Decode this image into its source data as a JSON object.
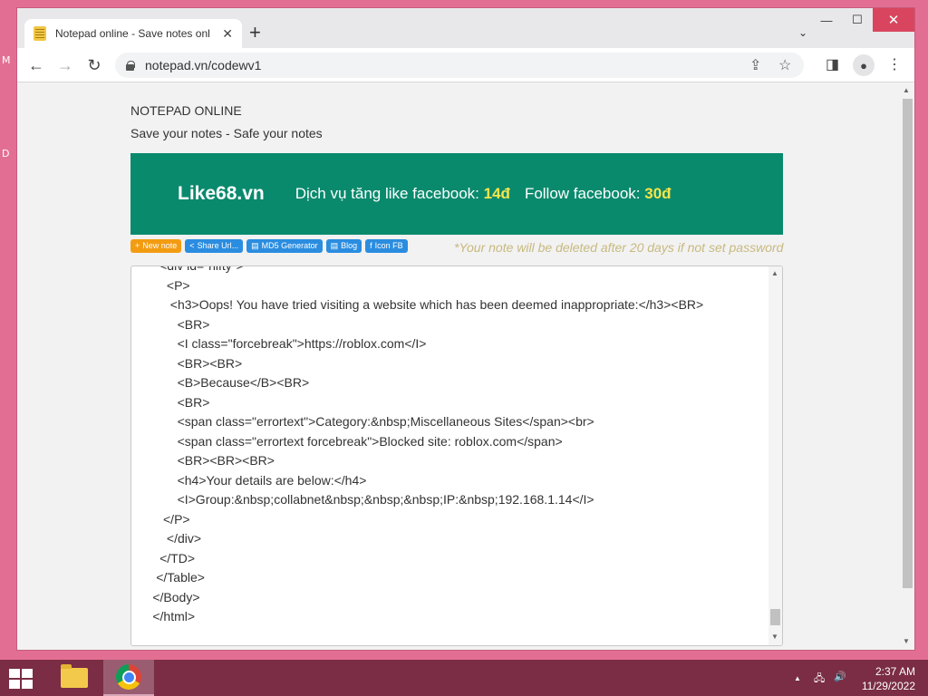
{
  "desktop": {
    "fragments": [
      "M",
      "D"
    ]
  },
  "browser": {
    "tab_title": "Notepad online - Save notes onl",
    "tab_close": "✕",
    "new_tab": "+",
    "tab_menu": "⌄",
    "caption": {
      "minimize": "—",
      "maximize": "☐",
      "close": "✕"
    },
    "nav": {
      "back": "←",
      "forward": "→",
      "reload": "↻"
    },
    "url": "notepad.vn/codewv1",
    "icons": {
      "share": "⇪",
      "star": "☆",
      "sidepanel": "◨",
      "profile": "●",
      "menu": "⋮"
    }
  },
  "page": {
    "site_title": "NOTEPAD ONLINE",
    "site_subtitle": "Save your notes - Safe your notes",
    "ad": {
      "brand": "Like68.vn",
      "text1": "Dịch vụ tăng like facebook:",
      "price1": "14đ",
      "text2": "Follow facebook:",
      "price2": "30đ"
    },
    "buttons": [
      {
        "icon": "+",
        "label": "New note",
        "color": "#f39c12"
      },
      {
        "icon": "<",
        "label": "Share Url...",
        "color": "#2b8de0"
      },
      {
        "icon": "▤",
        "label": "MD5 Generator",
        "color": "#2b8de0"
      },
      {
        "icon": "▤",
        "label": "Blog",
        "color": "#2b8de0"
      },
      {
        "icon": "f",
        "label": "Icon FB",
        "color": "#2b8de0"
      }
    ],
    "warning": "*Your note will be deleted after 20 days if not set password",
    "editor_lines": [
      "        <div id=\"nifty\">",
      "          <P>",
      "           <h3>Oops! You have tried visiting a website which has been deemed inappropriate:</h3><BR>",
      "             <BR>",
      "             <I class=\"forcebreak\">https://roblox.com</I>",
      "             <BR><BR>",
      "             <B>Because</B><BR>",
      "             <BR>",
      "             <span class=\"errortext\">Category:&nbsp;Miscellaneous Sites</span><br>",
      "             <span class=\"errortext forcebreak\">Blocked site: roblox.com</span>",
      "             <BR><BR><BR>",
      "             <h4>Your details are below:</h4>",
      "             <I>Group:&nbsp;collabnet&nbsp;&nbsp;&nbsp;IP:&nbsp;192.168.1.14</I>",
      "         </P>",
      "          </div>",
      "        </TD>",
      "       </Table>",
      "      </Body>",
      "      </html>"
    ]
  },
  "taskbar": {
    "time": "2:37 AM",
    "date": "11/29/2022",
    "tray_chevron": "▲",
    "network": "🖧",
    "volume": "🔊"
  },
  "colors": {
    "desktop": "#e26f93",
    "ad_bg": "#0a8a6d",
    "ad_price": "#f7e54a",
    "warning": "#c7b97f",
    "taskbar": "#7a2d44"
  }
}
